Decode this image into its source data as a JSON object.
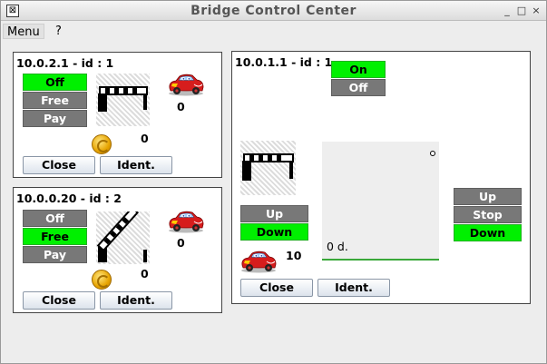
{
  "window": {
    "title": "Bridge Control Center",
    "icon": "app-icon",
    "controls": [
      "_",
      "□",
      "×"
    ]
  },
  "menu": [
    "Menu",
    "?"
  ],
  "barrier1": {
    "title": "10.0.2.1 - id : 1",
    "modes": [
      "Off",
      "Free",
      "Pay"
    ],
    "active_mode": "Off",
    "gate_state": "closed",
    "car_count": "0",
    "coin_count": "0",
    "close_label": "Close",
    "ident_label": "Ident."
  },
  "barrier2": {
    "title": "10.0.0.20 - id : 2",
    "modes": [
      "Off",
      "Free",
      "Pay"
    ],
    "active_mode": "Free",
    "gate_state": "open",
    "car_count": "0",
    "coin_count": "0",
    "close_label": "Close",
    "ident_label": "Ident."
  },
  "bridge": {
    "title": "10.0.1.1 - id : 1",
    "power": [
      "On",
      "Off"
    ],
    "active_power": "On",
    "barrier_buttons": [
      "Up",
      "Down"
    ],
    "active_barrier": "Down",
    "car_count": "10",
    "monitor_text": "0 d.",
    "deck_buttons": [
      "Up",
      "Stop",
      "Down"
    ],
    "active_deck": "Down",
    "close_label": "Close",
    "ident_label": "Ident."
  },
  "colors": {
    "active": "#00f000",
    "inactive": "#787878"
  }
}
